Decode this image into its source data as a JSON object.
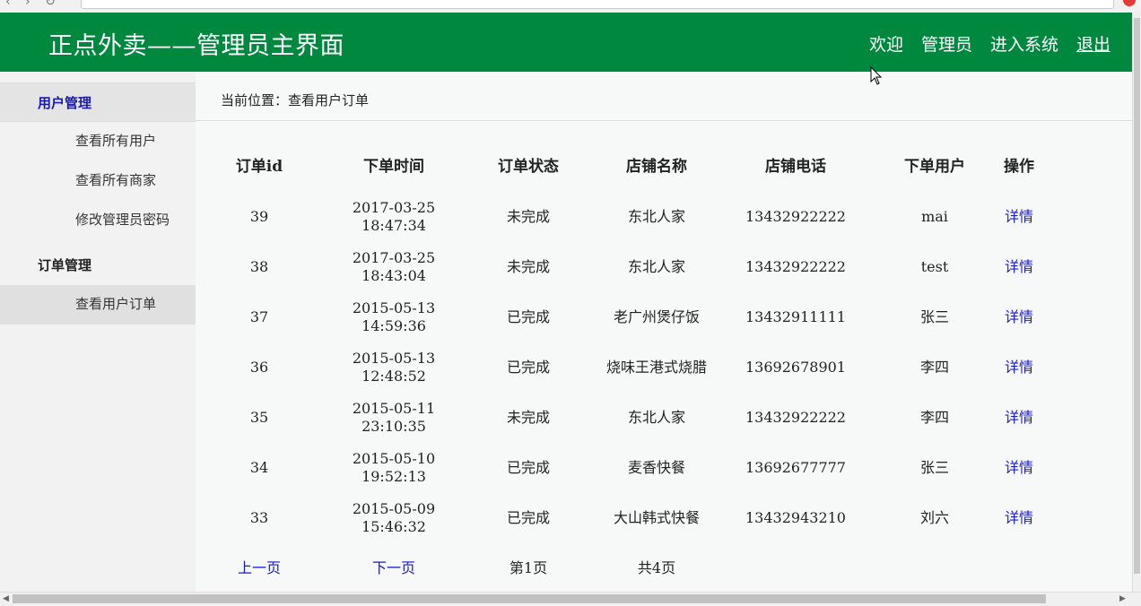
{
  "header": {
    "title": "正点外卖——管理员主界面",
    "nav": {
      "welcome": "欢迎",
      "user": "管理员",
      "enter": "进入系统",
      "logout": "退出"
    }
  },
  "sidebar": {
    "groups": [
      {
        "title": "用户管理",
        "items": [
          "查看所有用户",
          "查看所有商家",
          "修改管理员密码"
        ]
      },
      {
        "title": "订单管理",
        "items": [
          "查看用户订单"
        ]
      }
    ]
  },
  "breadcrumb": {
    "label": "当前位置：",
    "value": "查看用户订单"
  },
  "table": {
    "headers": [
      "订单id",
      "下单时间",
      "订单状态",
      "店铺名称",
      "店铺电话",
      "下单用户",
      "操作"
    ],
    "rows": [
      {
        "id": "39",
        "date": "2017-03-25",
        "time": "18:47:34",
        "status": "未完成",
        "shop": "东北人家",
        "phone": "13432922222",
        "user": "mai",
        "action": "详情"
      },
      {
        "id": "38",
        "date": "2017-03-25",
        "time": "18:43:04",
        "status": "未完成",
        "shop": "东北人家",
        "phone": "13432922222",
        "user": "test",
        "action": "详情"
      },
      {
        "id": "37",
        "date": "2015-05-13",
        "time": "14:59:36",
        "status": "已完成",
        "shop": "老广州煲仔饭",
        "phone": "13432911111",
        "user": "张三",
        "action": "详情"
      },
      {
        "id": "36",
        "date": "2015-05-13",
        "time": "12:48:52",
        "status": "已完成",
        "shop": "烧味王港式烧腊",
        "phone": "13692678901",
        "user": "李四",
        "action": "详情"
      },
      {
        "id": "35",
        "date": "2015-05-11",
        "time": "23:10:35",
        "status": "未完成",
        "shop": "东北人家",
        "phone": "13432922222",
        "user": "李四",
        "action": "详情"
      },
      {
        "id": "34",
        "date": "2015-05-10",
        "time": "19:52:13",
        "status": "已完成",
        "shop": "麦香快餐",
        "phone": "13692677777",
        "user": "张三",
        "action": "详情"
      },
      {
        "id": "33",
        "date": "2015-05-09",
        "time": "15:46:32",
        "status": "已完成",
        "shop": "大山韩式快餐",
        "phone": "13432943210",
        "user": "刘六",
        "action": "详情"
      }
    ]
  },
  "pager": {
    "prev": "上一页",
    "next": "下一页",
    "current": "第1页",
    "total": "共4页"
  },
  "colors": {
    "header_bg": "#00883f",
    "link": "#1a1ac8",
    "active_group": "#1a1aa8"
  }
}
